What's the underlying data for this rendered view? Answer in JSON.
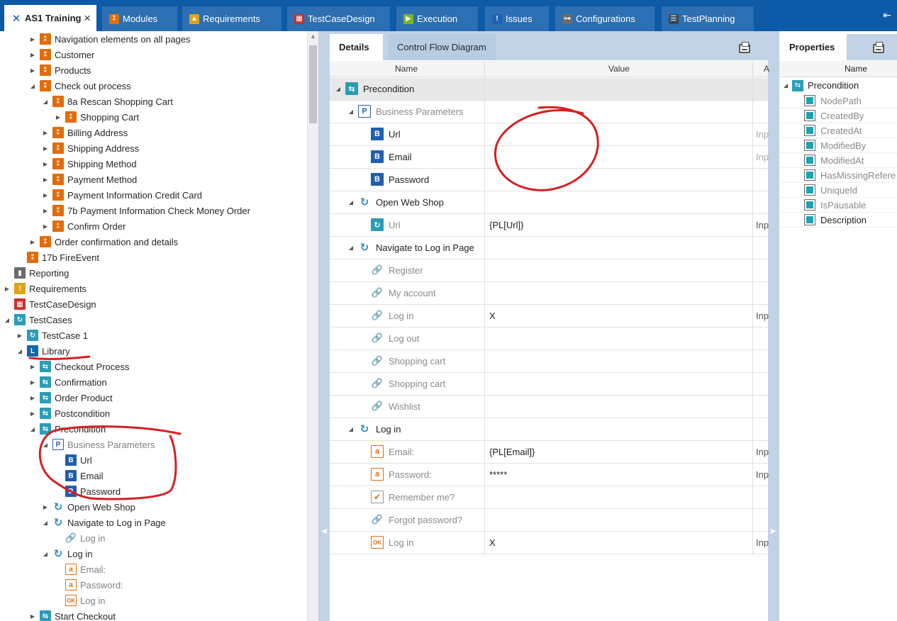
{
  "tabs": [
    {
      "label": "AS1 Training",
      "icon": "tosca-logo-icon",
      "active": true,
      "close": "×"
    },
    {
      "label": "Modules",
      "icon": "module-icon",
      "color": "#e36c0a"
    },
    {
      "label": "Requirements",
      "icon": "requirement-icon",
      "color": "#e0a21a"
    },
    {
      "label": "TestCaseDesign",
      "icon": "testcasedesign-icon",
      "color": "#c9302c"
    },
    {
      "label": "Execution",
      "icon": "execution-icon",
      "color": "#7ab51d"
    },
    {
      "label": "Issues",
      "icon": "issue-icon",
      "color": "#1f5fae"
    },
    {
      "label": "Configurations",
      "icon": "configuration-icon",
      "color": "#6b6b6b"
    },
    {
      "label": "TestPlanning",
      "icon": "testplanning-icon",
      "color": "#3a4a5a"
    }
  ],
  "tree": [
    {
      "label": "Navigation elements on all pages",
      "icon": "module-folder-icon",
      "arrow": "▶",
      "glyph": "⁑"
    },
    {
      "label": "Customer",
      "icon": "module-folder-icon",
      "arrow": "▶",
      "glyph": "⁑"
    },
    {
      "label": "Products",
      "icon": "module-folder-icon",
      "arrow": "▶",
      "glyph": "⁑"
    },
    {
      "label": "Check out process",
      "icon": "module-folder-icon",
      "arrow": "◢",
      "glyph": "⁑"
    },
    {
      "label": "8a Rescan Shopping Cart",
      "icon": "module-folder-icon",
      "arrow": "◢",
      "glyph": "⁑"
    },
    {
      "label": "Shopping Cart",
      "icon": "module-icon",
      "arrow": "▶",
      "glyph": "⁑"
    },
    {
      "label": "Billing Address",
      "icon": "module-icon",
      "arrow": "▶",
      "glyph": "⁑"
    },
    {
      "label": "Shipping Address",
      "icon": "module-icon",
      "arrow": "▶",
      "glyph": "⁑"
    },
    {
      "label": "Shipping Method",
      "icon": "module-icon",
      "arrow": "▶",
      "glyph": "⁑"
    },
    {
      "label": "Payment Method",
      "icon": "module-icon",
      "arrow": "▶",
      "glyph": "⁑"
    },
    {
      "label": "Payment Information Credit Card",
      "icon": "module-icon",
      "arrow": "▶",
      "glyph": "⁑"
    },
    {
      "label": "7b Payment Information Check Money Order",
      "icon": "module-folder-icon",
      "arrow": "▶",
      "glyph": "⁑"
    },
    {
      "label": "Confirm Order",
      "icon": "module-icon",
      "arrow": "▶",
      "glyph": "⁑"
    },
    {
      "label": "Order confirmation and details",
      "icon": "module-folder-icon",
      "arrow": "▶",
      "glyph": "⁑"
    },
    {
      "label": "17b FireEvent",
      "icon": "module-folder-icon",
      "arrow": "",
      "glyph": "⁑"
    },
    {
      "label": "Reporting",
      "icon": "reporting-icon",
      "arrow": "",
      "glyph": "▮"
    },
    {
      "label": "Requirements",
      "icon": "requirements-icon",
      "arrow": "▶",
      "glyph": "!"
    },
    {
      "label": "TestCaseDesign",
      "icon": "testcasedesign-icon",
      "arrow": "",
      "glyph": "▦"
    },
    {
      "label": "TestCases",
      "icon": "testcases-icon",
      "arrow": "◢",
      "glyph": "↻"
    },
    {
      "label": "TestCase 1",
      "icon": "testcase-icon",
      "arrow": "▶",
      "glyph": "↻"
    },
    {
      "label": "Library",
      "icon": "library-icon",
      "arrow": "◢",
      "glyph": "L"
    },
    {
      "label": "Checkout Process",
      "icon": "reusable-folder-icon",
      "arrow": "▶",
      "glyph": "⇆"
    },
    {
      "label": "Confirmation",
      "icon": "reusable-folder-icon",
      "arrow": "▶",
      "glyph": "⇆"
    },
    {
      "label": "Order Product",
      "icon": "reusable-folder-icon",
      "arrow": "▶",
      "glyph": "⇆"
    },
    {
      "label": "Postcondition",
      "icon": "reusable-folder-icon",
      "arrow": "▶",
      "glyph": "⇆"
    },
    {
      "label": "Precondition",
      "icon": "reusable-folder-icon",
      "arrow": "◢",
      "glyph": "⇆",
      "selected": true
    },
    {
      "label": "Business Parameters",
      "icon": "business-parameters-icon",
      "arrow": "◢",
      "glyph": "P",
      "dim": true
    },
    {
      "label": "Url",
      "icon": "business-parameter-icon",
      "arrow": "",
      "glyph": "B"
    },
    {
      "label": "Email",
      "icon": "business-parameter-icon",
      "arrow": "",
      "glyph": "B"
    },
    {
      "label": "Password",
      "icon": "business-parameter-icon",
      "arrow": "",
      "glyph": "B"
    },
    {
      "label": "Open Web Shop",
      "icon": "teststep-loop-icon",
      "arrow": "▶",
      "glyph": "↻"
    },
    {
      "label": "Navigate to Log in Page",
      "icon": "teststep-loop-icon",
      "arrow": "◢",
      "glyph": "↻"
    },
    {
      "label": "Log in",
      "icon": "link-icon",
      "arrow": "",
      "glyph": "🔗",
      "dim": true
    },
    {
      "label": "Log in",
      "icon": "teststep-loop-icon",
      "arrow": "◢",
      "glyph": "↻"
    },
    {
      "label": "Email:",
      "icon": "text-field-icon",
      "arrow": "",
      "glyph": "a",
      "dim": true
    },
    {
      "label": "Password:",
      "icon": "text-field-icon",
      "arrow": "",
      "glyph": "a",
      "dim": true
    },
    {
      "label": "Log in",
      "icon": "ok-button-icon",
      "arrow": "",
      "glyph": "OK",
      "dim": true
    },
    {
      "label": "Start Checkout",
      "icon": "reusable-folder-icon",
      "arrow": "▶",
      "glyph": "⇆"
    }
  ],
  "details": {
    "tab_details": "Details",
    "tab_flow": "Control Flow Diagram",
    "col_name": "Name",
    "col_value": "Value",
    "col_action": "A",
    "rows": [
      {
        "name": "Precondition",
        "value": "",
        "action": "",
        "icon": "reusable-folder-icon",
        "glyph": "⇆",
        "arrow": "◢",
        "group": true
      },
      {
        "name": "Business Parameters",
        "value": "",
        "action": "",
        "icon": "business-parameters-icon",
        "glyph": "P",
        "arrow": "◢",
        "dim": true
      },
      {
        "name": "Url",
        "value": "",
        "action": "Inp",
        "icon": "business-parameter-icon",
        "glyph": "B",
        "arrow": "",
        "action_dim": true
      },
      {
        "name": "Email",
        "value": "",
        "action": "Inp",
        "icon": "business-parameter-icon",
        "glyph": "B",
        "arrow": "",
        "action_dim": true
      },
      {
        "name": "Password",
        "value": "",
        "action": "",
        "icon": "business-parameter-icon",
        "glyph": "B",
        "arrow": ""
      },
      {
        "name": "Open Web Shop",
        "value": "",
        "action": "",
        "icon": "teststep-loop-icon",
        "glyph": "↻",
        "arrow": "◢"
      },
      {
        "name": "Url",
        "value": "{PL[Url]}",
        "action": "Inp",
        "icon": "teststep-value-icon",
        "glyph": "↻",
        "arrow": "",
        "dim": true
      },
      {
        "name": "Navigate to Log in Page",
        "value": "",
        "action": "",
        "icon": "teststep-loop-icon",
        "glyph": "↻",
        "arrow": "◢"
      },
      {
        "name": "Register",
        "value": "",
        "action": "",
        "icon": "link-icon",
        "glyph": "🔗",
        "arrow": "",
        "dim": true
      },
      {
        "name": "My account",
        "value": "",
        "action": "",
        "icon": "link-icon",
        "glyph": "🔗",
        "arrow": "",
        "dim": true
      },
      {
        "name": "Log in",
        "value": "X",
        "action": "Inp",
        "icon": "link-icon",
        "glyph": "🔗",
        "arrow": "",
        "dim": true
      },
      {
        "name": "Log out",
        "value": "",
        "action": "",
        "icon": "link-icon",
        "glyph": "🔗",
        "arrow": "",
        "dim": true
      },
      {
        "name": "Shopping cart",
        "value": "",
        "action": "",
        "icon": "link-icon",
        "glyph": "🔗",
        "arrow": "",
        "dim": true
      },
      {
        "name": "Shopping cart",
        "value": "",
        "action": "",
        "icon": "link-icon",
        "glyph": "🔗",
        "arrow": "",
        "dim": true
      },
      {
        "name": "Wishlist",
        "value": "",
        "action": "",
        "icon": "link-icon",
        "glyph": "🔗",
        "arrow": "",
        "dim": true
      },
      {
        "name": "Log in",
        "value": "",
        "action": "",
        "icon": "teststep-loop-icon",
        "glyph": "↻",
        "arrow": "◢"
      },
      {
        "name": "Email:",
        "value": "{PL[Email]}",
        "action": "Inp",
        "icon": "text-field-icon",
        "glyph": "a",
        "arrow": "",
        "dim": true
      },
      {
        "name": "Password:",
        "value": "*****",
        "action": "Inp",
        "icon": "text-field-icon",
        "glyph": "a",
        "arrow": "",
        "dim": true
      },
      {
        "name": "Remember me?",
        "value": "",
        "action": "",
        "icon": "checkbox-icon",
        "glyph": "✔",
        "arrow": "",
        "dim": true
      },
      {
        "name": "Forgot password?",
        "value": "",
        "action": "",
        "icon": "link-icon",
        "glyph": "🔗",
        "arrow": "",
        "dim": true
      },
      {
        "name": "Log in",
        "value": "X",
        "action": "Inp",
        "icon": "ok-button-icon",
        "glyph": "OK",
        "arrow": "",
        "dim": true
      }
    ]
  },
  "properties": {
    "tab": "Properties",
    "col_name": "Name",
    "root": {
      "label": "Precondition",
      "arrow": "◢",
      "glyph": "⇆"
    },
    "items": [
      {
        "label": "NodePath",
        "dim": true
      },
      {
        "label": "CreatedBy",
        "dim": true
      },
      {
        "label": "CreatedAt",
        "dim": true
      },
      {
        "label": "ModifiedBy",
        "dim": true
      },
      {
        "label": "ModifiedAt",
        "dim": true
      },
      {
        "label": "HasMissingRefere",
        "dim": true
      },
      {
        "label": "UniqueId",
        "dim": true
      },
      {
        "label": "IsPausable",
        "dim": true
      },
      {
        "label": "Description",
        "dim": false
      }
    ]
  },
  "colors": {
    "tabbar": "#0d5aa7",
    "pane_bg": "#c2d3e6",
    "selection": "#d6e8f8",
    "annotation": "#d62020"
  }
}
